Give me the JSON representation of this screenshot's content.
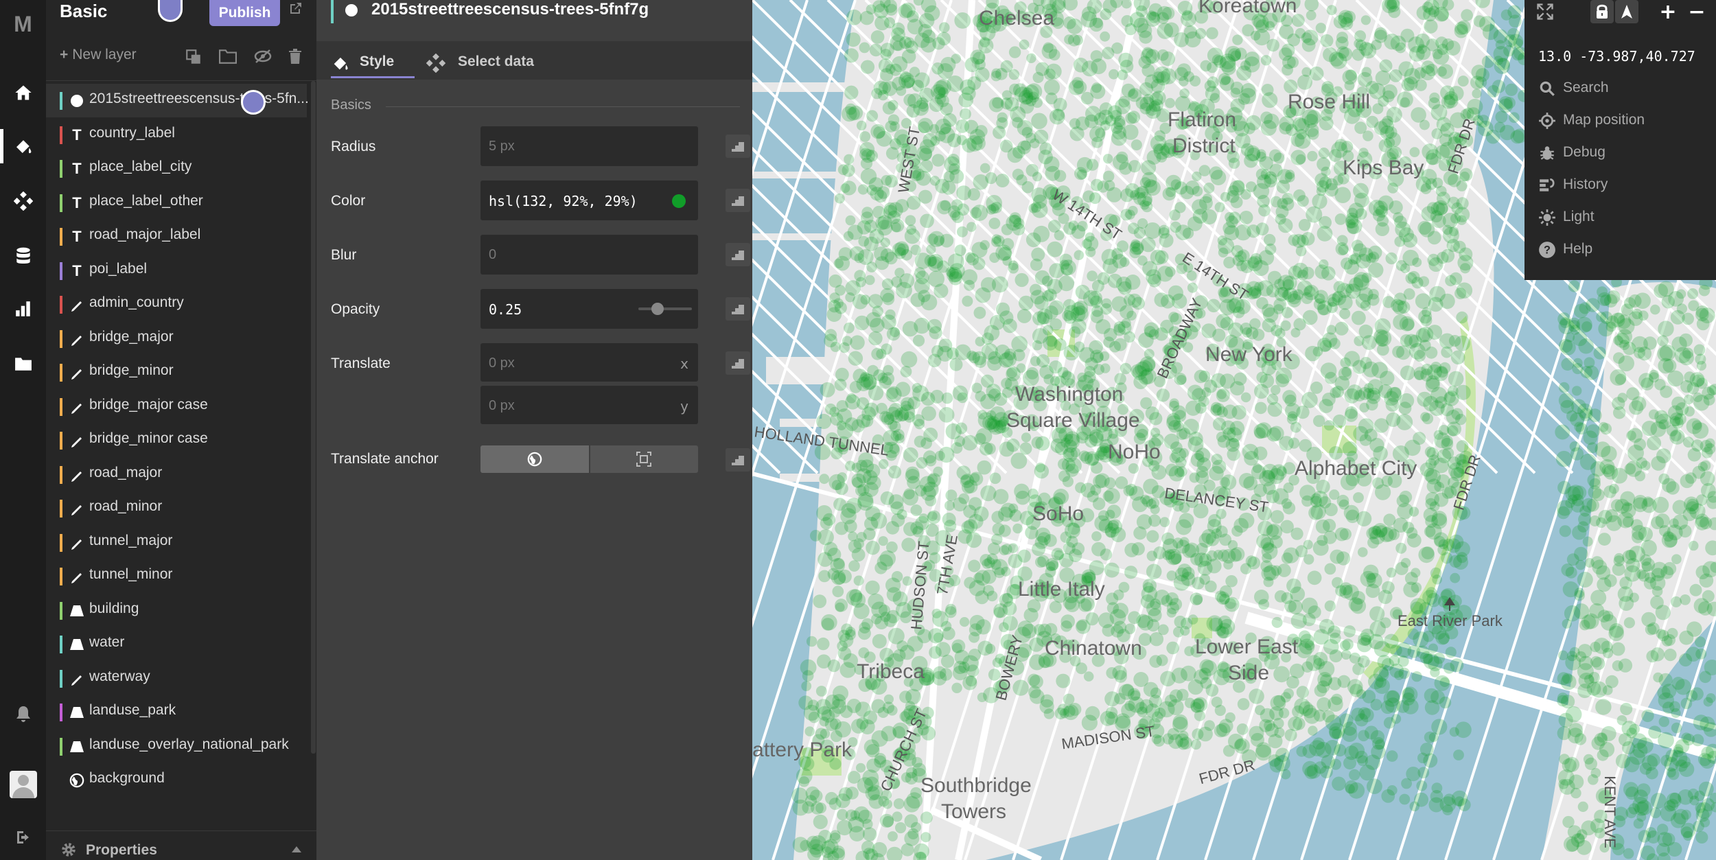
{
  "rail": {
    "logo": "M",
    "items": [
      "home-icon",
      "paint-brush-icon",
      "data-sources-icon",
      "database-icon",
      "chart-icon",
      "folder-icon"
    ],
    "bottom": [
      "bell-icon",
      "avatar",
      "logout-icon"
    ]
  },
  "layers_panel": {
    "title": "Basic",
    "publish_label": "Publish",
    "new_layer_label": "New layer",
    "properties_label": "Properties",
    "items": [
      {
        "label": "2015streettreescensus-trees-5fn...",
        "type": "circle",
        "color": "#6fd0c4"
      },
      {
        "label": "country_label",
        "type": "symbol",
        "color": "#d9534f"
      },
      {
        "label": "place_label_city",
        "type": "symbol",
        "color": "#8fd06f"
      },
      {
        "label": "place_label_other",
        "type": "symbol",
        "color": "#8fd06f"
      },
      {
        "label": "road_major_label",
        "type": "symbol",
        "color": "#f0ad4e"
      },
      {
        "label": "poi_label",
        "type": "symbol",
        "color": "#9b7fd6"
      },
      {
        "label": "admin_country",
        "type": "line",
        "color": "#d9534f"
      },
      {
        "label": "bridge_major",
        "type": "line",
        "color": "#f0ad4e"
      },
      {
        "label": "bridge_minor",
        "type": "line",
        "color": "#f0ad4e"
      },
      {
        "label": "bridge_major case",
        "type": "line",
        "color": "#f0ad4e"
      },
      {
        "label": "bridge_minor case",
        "type": "line",
        "color": "#f0ad4e"
      },
      {
        "label": "road_major",
        "type": "line",
        "color": "#f0ad4e"
      },
      {
        "label": "road_minor",
        "type": "line",
        "color": "#f0ad4e"
      },
      {
        "label": "tunnel_major",
        "type": "line",
        "color": "#f0ad4e"
      },
      {
        "label": "tunnel_minor",
        "type": "line",
        "color": "#f0ad4e"
      },
      {
        "label": "building",
        "type": "fill",
        "color": "#8fd06f"
      },
      {
        "label": "water",
        "type": "fill",
        "color": "#6fd0c4"
      },
      {
        "label": "waterway",
        "type": "line",
        "color": "#6fd0c4"
      },
      {
        "label": "landuse_park",
        "type": "fill",
        "color": "#c45fd6"
      },
      {
        "label": "landuse_overlay_national_park",
        "type": "fill",
        "color": "#8fd06f"
      },
      {
        "label": "background",
        "type": "background",
        "color": ""
      }
    ]
  },
  "editor": {
    "layer_title": "2015streettreescensus-trees-5fnf7g",
    "tabs": {
      "style": "Style",
      "select_data": "Select data"
    },
    "section_basics": "Basics",
    "radius": {
      "label": "Radius",
      "placeholder": "5 px"
    },
    "color": {
      "label": "Color",
      "value": "hsl(132, 92%, 29%)",
      "swatch": "#119d29"
    },
    "blur": {
      "label": "Blur",
      "placeholder": "0"
    },
    "opacity": {
      "label": "Opacity",
      "value": "0.25",
      "level": 0.25
    },
    "translate": {
      "label": "Translate",
      "x_placeholder": "0 px",
      "x_suffix": "x",
      "y_placeholder": "0 px",
      "y_suffix": "y"
    },
    "translate_anchor": {
      "label": "Translate anchor",
      "options": [
        "map",
        "viewport"
      ],
      "selected": "map"
    }
  },
  "map": {
    "labels": [
      "Chelsea",
      "Koreatown",
      "Flatiron District",
      "Rose Hill",
      "Kips Bay",
      "W 14TH ST",
      "E 14TH ST",
      "BROADWAY",
      "New York",
      "Washington Square Village",
      "NoHo",
      "SoHo",
      "Little Italy",
      "Chinatown",
      "Lower East Side",
      "Tribeca",
      "Southbridge Towers",
      "Battery Park",
      "East River Park",
      "Alphabet City",
      "HOLLAND TUNNEL",
      "FDR DR",
      "HUDSON ST",
      "CHURCH ST",
      "MADISON ST",
      "DELANCEY ST",
      "KENT AVE",
      "WEST ST",
      "BOWERY",
      "7TH AVE"
    ]
  },
  "map_controls": {
    "zoom": "13.0",
    "coords": "-73.987,40.727",
    "items": [
      {
        "label": "Search",
        "icon": "search-icon"
      },
      {
        "label": "Map position",
        "icon": "crosshair-icon"
      },
      {
        "label": "Debug",
        "icon": "bug-icon"
      },
      {
        "label": "History",
        "icon": "history-icon"
      },
      {
        "label": "Light",
        "icon": "sun-icon"
      },
      {
        "label": "Help",
        "icon": "help-icon"
      }
    ]
  }
}
